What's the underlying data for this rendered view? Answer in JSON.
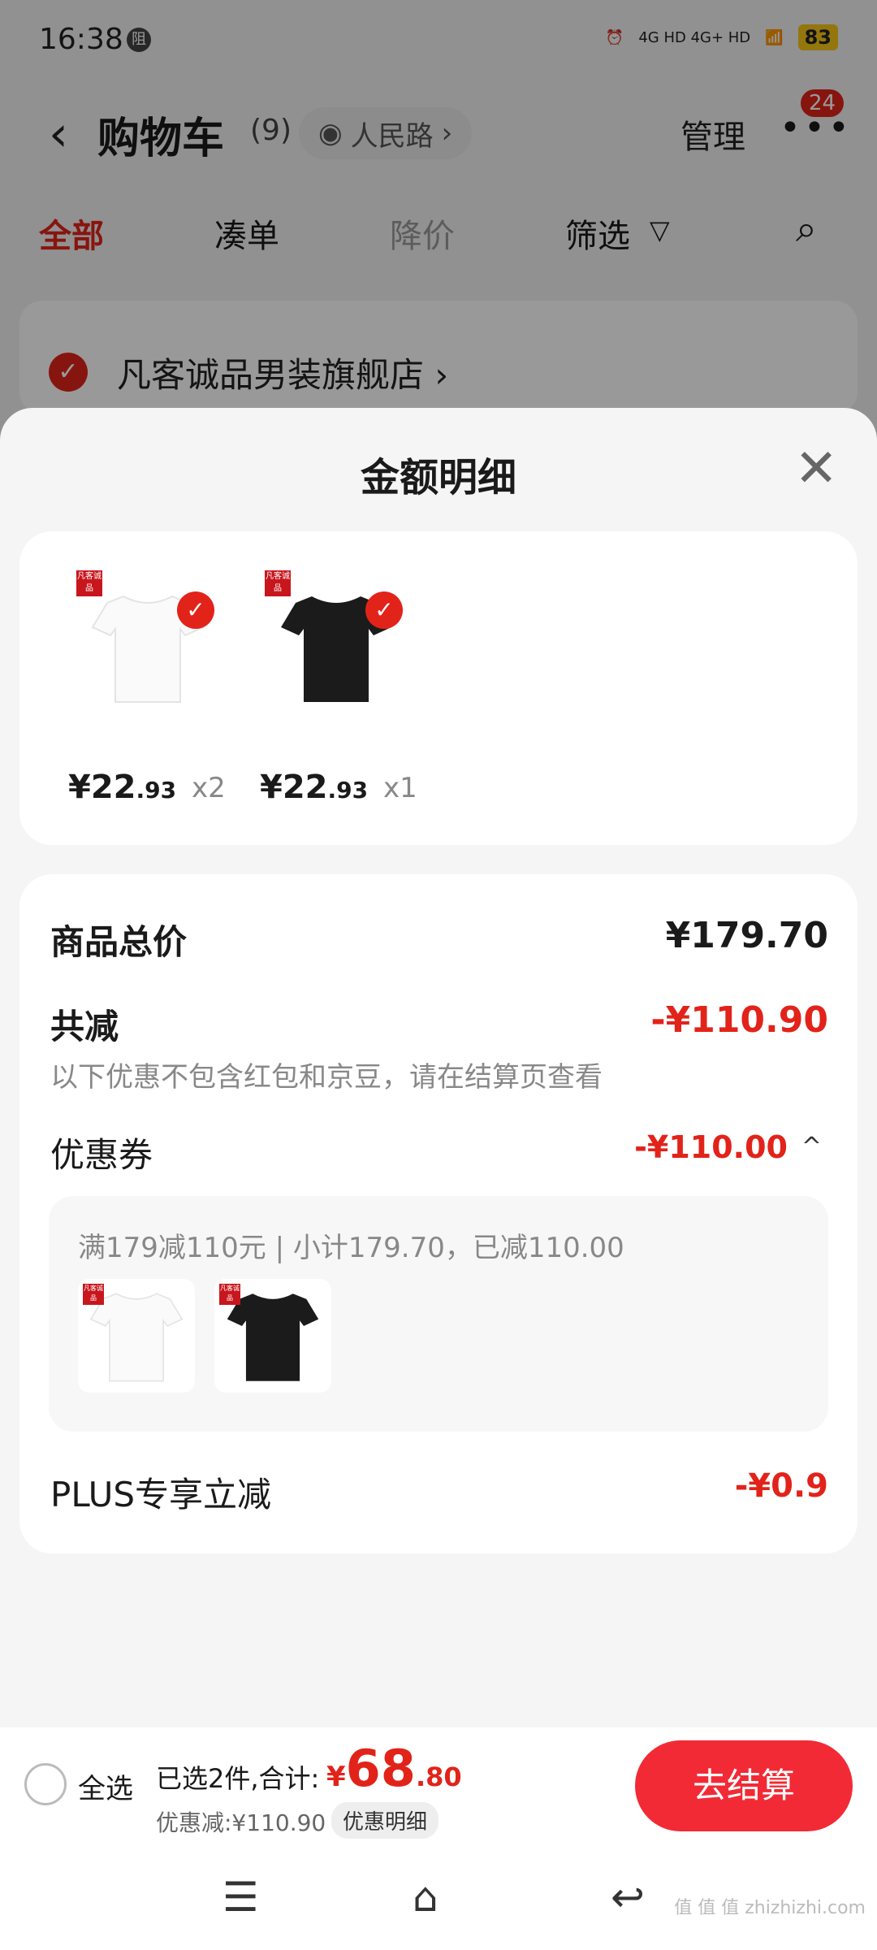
{
  "status": {
    "time": "16:38",
    "icon": "阻",
    "net": "4G HD  4G+ HD",
    "battery": "83"
  },
  "header": {
    "back": "‹",
    "title": "购物车",
    "count": "(9)",
    "location": "人民路",
    "location_chevron": "›",
    "manage": "管理",
    "more": "•••",
    "badge": "24"
  },
  "tabs": {
    "all": "全部",
    "bundle": "凑单",
    "price_drop": "降价",
    "filter": "筛选",
    "filter_icon": "▽"
  },
  "store": {
    "name": "凡客诚品男装旗舰店",
    "chevron": "›"
  },
  "sheet": {
    "title": "金额明细",
    "items": [
      {
        "price": "¥22",
        "cents": ".93",
        "qty": "x2",
        "color": "white",
        "tag": "凡客诚品"
      },
      {
        "price": "¥22",
        "cents": ".93",
        "qty": "x1",
        "color": "black",
        "tag": "凡客诚品"
      }
    ],
    "total_label": "商品总价",
    "total_value": "¥179.70",
    "reduce_label": "共减",
    "reduce_value": "-¥110.90",
    "reduce_note": "以下优惠不包含红包和京豆，请在结算页查看",
    "coupon_label": "优惠券",
    "coupon_value": "-¥110.00",
    "coupon_chevron": "^",
    "coupon_detail": "满179减110元 | 小计179.70，已减110.00",
    "plus_label": "PLUS专享立减",
    "plus_value": "-¥0.9"
  },
  "bottom": {
    "select_all": "全选",
    "selected": "已选2件,合计:",
    "currency": "¥",
    "total_main": "68",
    "total_cents": ".80",
    "discount": "优惠减:¥110.90",
    "detail_button": "优惠明细",
    "checkout": "去结算"
  },
  "watermark": "值 值 值  zhizhizhi.com"
}
